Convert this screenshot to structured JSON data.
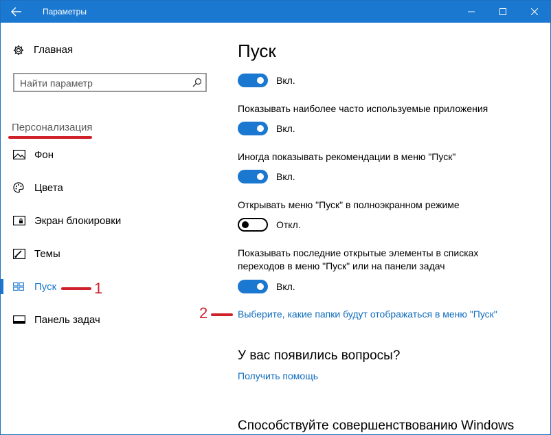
{
  "window": {
    "title": "Параметры"
  },
  "sidebar": {
    "home_label": "Главная",
    "search_placeholder": "Найти параметр",
    "section_header": "Персонализация",
    "items": [
      {
        "label": "Фон",
        "icon": "picture-icon"
      },
      {
        "label": "Цвета",
        "icon": "palette-icon"
      },
      {
        "label": "Экран блокировки",
        "icon": "lock-screen-icon"
      },
      {
        "label": "Темы",
        "icon": "themes-icon"
      },
      {
        "label": "Пуск",
        "icon": "start-tiles-icon",
        "active": true
      },
      {
        "label": "Панель задач",
        "icon": "taskbar-icon"
      }
    ]
  },
  "annotations": {
    "marker_1": "1",
    "marker_2": "2"
  },
  "main": {
    "title": "Пуск",
    "settings": [
      {
        "label": "",
        "state": "Вкл.",
        "on": true
      },
      {
        "label": "Показывать наиболее часто используемые приложения",
        "state": "Вкл.",
        "on": true
      },
      {
        "label": "Иногда показывать рекомендации в меню \"Пуск\"",
        "state": "Вкл.",
        "on": true
      },
      {
        "label": "Открывать меню \"Пуск\" в полноэкранном режиме",
        "state": "Откл.",
        "on": false
      },
      {
        "label": "Показывать последние открытые элементы в списках переходов в меню \"Пуск\" или на панели задач",
        "state": "Вкл.",
        "on": true
      }
    ],
    "folders_link": "Выберите, какие папки будут отображаться в меню \"Пуск\"",
    "questions_heading": "У вас появились вопросы?",
    "help_link": "Получить помощь",
    "improve_heading": "Способствуйте совершенствованию Windows"
  },
  "colors": {
    "accent": "#1b78d1",
    "annotation_red": "#d0212a",
    "link": "#0f6cbd"
  }
}
